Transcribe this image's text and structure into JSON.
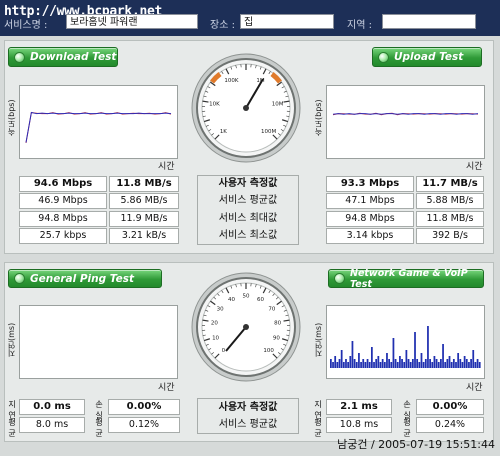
{
  "top": {
    "watermark": "http://www.bcpark.net",
    "service_label": "서비스명 :",
    "service_value": "보라홈넷 파워랜",
    "place_label": "장소 :",
    "place_value": "집",
    "region_label": "지역 :",
    "region_value": ""
  },
  "download": {
    "title": "Download Test",
    "y_axis": "속도(bps)",
    "x_axis": "시간",
    "chart_data": {
      "type": "line",
      "series": [
        {
          "values": [
            0.2,
            0.72,
            0.7,
            0.71,
            0.7,
            0.71,
            0.7,
            0.7,
            0.71,
            0.7,
            0.7,
            0.71,
            0.7,
            0.7,
            0.71,
            0.7,
            0.7,
            0.71,
            0.7,
            0.7,
            0.7,
            0.71,
            0.7,
            0.7,
            0.7,
            0.7,
            0.71,
            0.7
          ]
        }
      ],
      "colors": [
        "#2b2bb8",
        "#d23a3a"
      ]
    }
  },
  "upload": {
    "title": "Upload Test",
    "y_axis": "속도(bps)",
    "x_axis": "시간",
    "chart_data": {
      "type": "line",
      "series": [
        {
          "values": [
            0.69,
            0.7,
            0.69,
            0.7,
            0.69,
            0.7,
            0.7,
            0.69,
            0.7,
            0.69,
            0.7,
            0.7,
            0.69,
            0.7,
            0.69,
            0.7,
            0.7,
            0.69,
            0.7,
            0.7,
            0.69,
            0.7,
            0.7,
            0.69,
            0.7,
            0.7,
            0.69,
            0.7
          ]
        }
      ],
      "colors": [
        "#2b2bb8",
        "#d23a3a"
      ]
    }
  },
  "speed_gauge": {
    "labels": [
      "1K",
      "10K",
      "100K",
      "1M",
      "10M",
      "100M"
    ],
    "needle_value": "10M-100M"
  },
  "speed_rows": {
    "labels": [
      "사용자 측정값",
      "서비스 평균값",
      "서비스 최대값",
      "서비스 최소값"
    ],
    "download": [
      {
        "bps": "94.6 Mbps",
        "Bps": "11.8 MB/s"
      },
      {
        "bps": "46.9 Mbps",
        "Bps": "5.86 MB/s"
      },
      {
        "bps": "94.8 Mbps",
        "Bps": "11.9 MB/s"
      },
      {
        "bps": "25.7 kbps",
        "Bps": "3.21 kB/s"
      }
    ],
    "upload": [
      {
        "bps": "93.3 Mbps",
        "Bps": "11.7 MB/s"
      },
      {
        "bps": "47.1 Mbps",
        "Bps": "5.88 MB/s"
      },
      {
        "bps": "94.8 Mbps",
        "Bps": "11.8 MB/s"
      },
      {
        "bps": "3.14 kbps",
        "Bps": "392 B/s"
      }
    ]
  },
  "ping": {
    "title": "General Ping Test",
    "y_axis": "지연(ms)",
    "x_axis": "시간",
    "values": {
      "delay": "0.0 ms",
      "loss": "0.00%"
    },
    "avg": {
      "delay": "8.0 ms",
      "loss": "0.12%"
    },
    "delay_label": "지연",
    "loss_label": "손실",
    "avg_label_1": "평균",
    "avg_label_2": "평균"
  },
  "game": {
    "title": "Network Game & VoIP Test",
    "y_axis": "지연(ms)",
    "x_axis": "시간",
    "values": {
      "delay": "2.1 ms",
      "loss": "0.00%"
    },
    "avg": {
      "delay": "10.8 ms",
      "loss": "0.24%"
    },
    "delay_label": "지연",
    "loss_label": "손실",
    "avg_label_1": "평균",
    "avg_label_2": "평균",
    "chart_data": {
      "type": "bar",
      "values": [
        3,
        2,
        4,
        2,
        3,
        6,
        2,
        3,
        2,
        4,
        9,
        3,
        2,
        5,
        2,
        3,
        2,
        3,
        2,
        7,
        2,
        3,
        4,
        2,
        3,
        2,
        5,
        3,
        2,
        10,
        3,
        2,
        4,
        3,
        2,
        6,
        3,
        2,
        3,
        12,
        3,
        2,
        5,
        2,
        3,
        14,
        3,
        2,
        4,
        3,
        2,
        3,
        8,
        2,
        3,
        4,
        2,
        3,
        2,
        5,
        3,
        2,
        4,
        3,
        2,
        3,
        6,
        2,
        3,
        2
      ]
    }
  },
  "ping_gauge": {
    "labels": [
      "0",
      "10",
      "20",
      "30",
      "40",
      "50",
      "60",
      "70",
      "80",
      "90",
      "100"
    ]
  },
  "ping_rows": {
    "labels": [
      "사용자 측정값",
      "서비스 평균값"
    ]
  },
  "status": "남궁건 / 2005-07-19 15:51:44"
}
